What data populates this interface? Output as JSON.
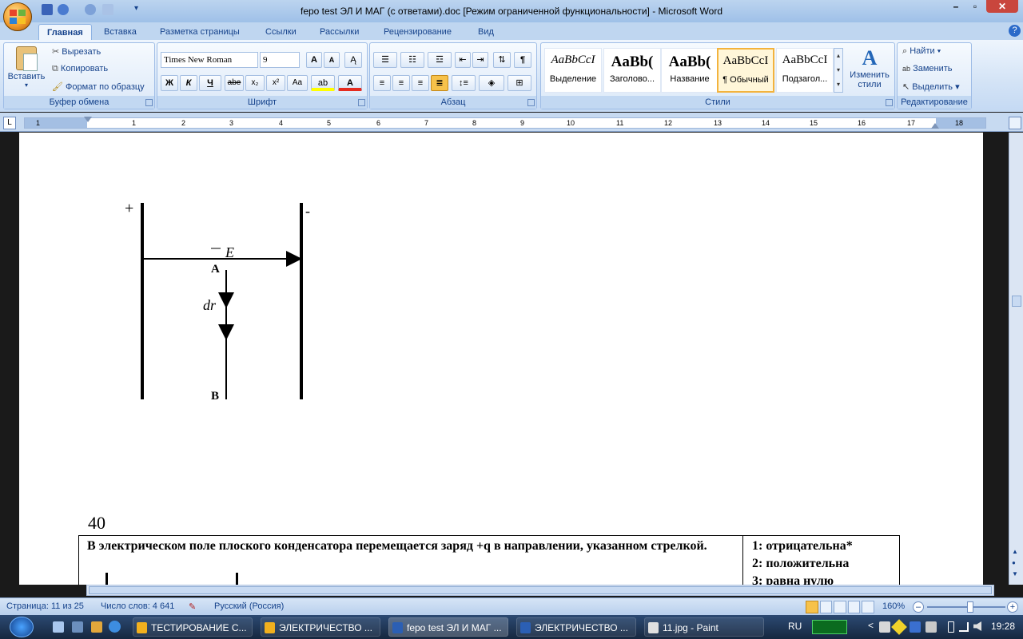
{
  "window": {
    "title": "fepo test ЭЛ И МАГ (с ответами).doc [Режим ограниченной функциональности] - Microsoft Word"
  },
  "tabs": [
    "Главная",
    "Вставка",
    "Разметка страницы",
    "Ссылки",
    "Рассылки",
    "Рецензирование",
    "Вид"
  ],
  "ribbon": {
    "clipboard": {
      "paste": "Вставить",
      "cut": "Вырезать",
      "copy": "Копировать",
      "format_painter": "Формат по образцу",
      "label": "Буфер обмена"
    },
    "font": {
      "font_name": "Times New Roman",
      "font_size": "9",
      "label": "Шрифт",
      "bold": "Ж",
      "italic": "К",
      "underline": "Ч",
      "strike": "abe",
      "subscript": "x₂",
      "superscript": "x²",
      "case": "Aa"
    },
    "paragraph": {
      "label": "Абзац"
    },
    "styles": {
      "label": "Стили",
      "tiles": [
        {
          "sample": "AaBbCcI",
          "name": "Выделение"
        },
        {
          "sample": "AaBb(",
          "name": "Заголово..."
        },
        {
          "sample": "AaBb(",
          "name": "Название"
        },
        {
          "sample": "AaBbCcI",
          "name": "¶ Обычный"
        },
        {
          "sample": "AaBbCcI",
          "name": "Подзагол..."
        }
      ],
      "change_styles": "Изменить стили"
    },
    "editing": {
      "label": "Редактирование",
      "find": "Найти",
      "replace": "Заменить",
      "select": "Выделить"
    }
  },
  "ruler": {
    "numbers": [
      "1",
      "1",
      "2",
      "3",
      "4",
      "5",
      "6",
      "7",
      "8",
      "9",
      "10",
      "11",
      "12",
      "13",
      "14",
      "15",
      "16",
      "17",
      "18"
    ]
  },
  "document": {
    "figure": {
      "plus": "+",
      "minus": "-",
      "field_label": "E",
      "point_a": "A",
      "dr_label": "dr",
      "point_b": "B"
    },
    "question_number": "40",
    "question_text": "В электрическом поле плоского конденсатора перемещается заряд +q в направлении, указанном стрелкой.",
    "answers": [
      "1: отрицательна*",
      "2: положительна",
      "3: равна нулю"
    ]
  },
  "status": {
    "page": "Страница: 11 из 25",
    "words": "Число слов: 4 641",
    "language": "Русский (Россия)",
    "zoom": "160%"
  },
  "taskbar": {
    "items": [
      {
        "label": "ТЕСТИРОВАНИЕ С...",
        "color": "#f2b01e"
      },
      {
        "label": "ЭЛЕКТРИЧЕСТВО ...",
        "color": "#f2b01e"
      },
      {
        "label": "fepo test ЭЛ И МАГ ...",
        "color": "#2b5fb4"
      },
      {
        "label": "ЭЛЕКТРИЧЕСТВО ...",
        "color": "#2b5fb4"
      },
      {
        "label": "11.jpg - Paint",
        "color": "#e0e0e0"
      }
    ],
    "lang": "RU",
    "time": "19:28"
  }
}
